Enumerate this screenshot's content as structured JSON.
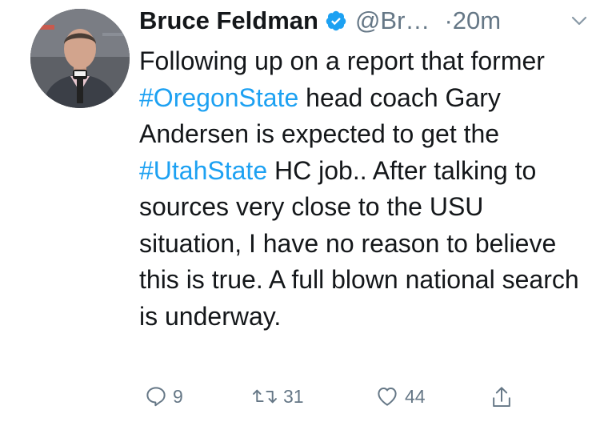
{
  "author": {
    "name": "Bruce Feldman",
    "handle": "@Br…",
    "separator": "·",
    "time": "20m",
    "verified": true
  },
  "tweet": {
    "parts": [
      {
        "text": "Following up on a report that former ",
        "hashtag": false
      },
      {
        "text": "#OregonState",
        "hashtag": true
      },
      {
        "text": " head coach Gary Andersen is expected to get the ",
        "hashtag": false
      },
      {
        "text": "#UtahState",
        "hashtag": true
      },
      {
        "text": " HC job.. After talking to sources very close to the USU situation, I have no reason to believe this is true. A full blown national search is underway.",
        "hashtag": false
      }
    ]
  },
  "actions": {
    "replies": "9",
    "retweets": "31",
    "likes": "44"
  },
  "icons": {
    "verified": "verified-badge-icon",
    "caret": "chevron-down-icon",
    "reply": "reply-icon",
    "retweet": "retweet-icon",
    "like": "heart-icon",
    "share": "share-icon"
  },
  "colors": {
    "accent": "#1da1f2",
    "text": "#14171a",
    "muted": "#657786"
  }
}
